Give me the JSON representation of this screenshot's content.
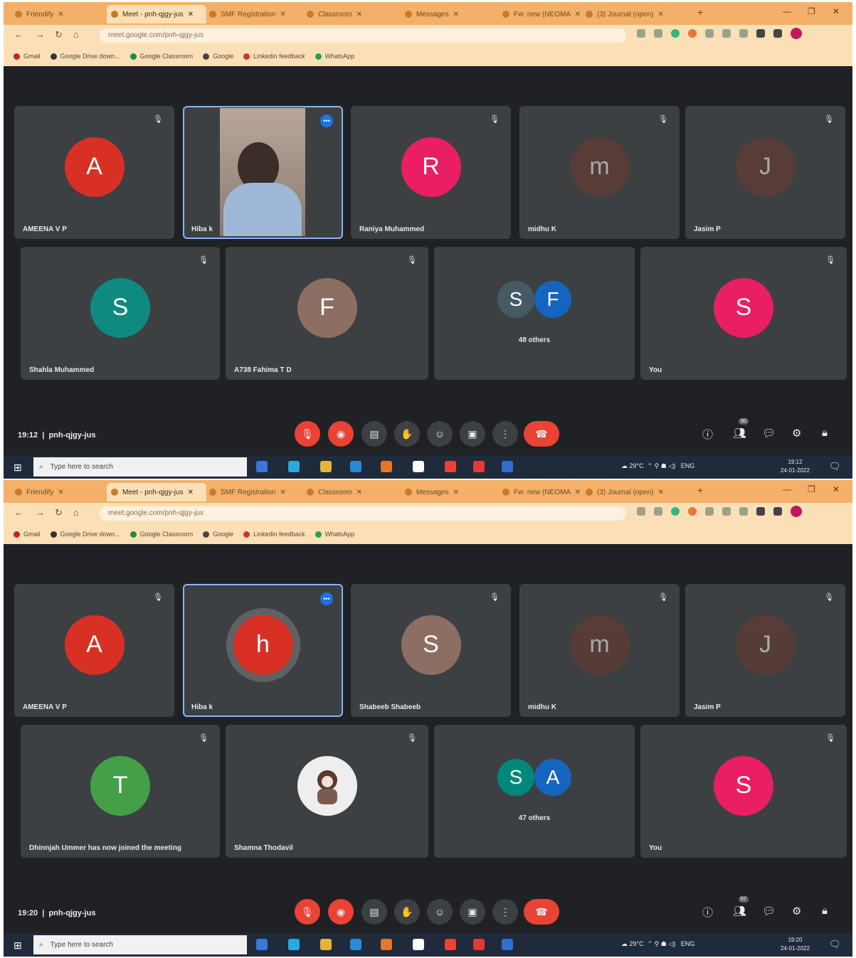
{
  "browser": {
    "tabs": [
      "Friendify",
      "Meet - pnh-qjgy-jus",
      "SMF Registration",
      "Classroom",
      "Messages",
      "Fw: new (NEOMA)",
      "(3) Journal (open)"
    ],
    "address": "meet.google.com/pnh-qjgy-jus",
    "bookmarks": [
      "Gmail",
      "Google Drive down...",
      "Google Classroom",
      "Google",
      "Linkedin feedback",
      "WhatsApp"
    ]
  },
  "screens": [
    {
      "meeting_time": "19:12",
      "meeting_code": "pnh-qjgy-jus",
      "people_count": "50",
      "tiles": [
        {
          "name": "AMEENA V P",
          "initial": "A",
          "color": "#d93025",
          "active": false,
          "video": false
        },
        {
          "name": "Hiba k",
          "initial": "",
          "color": "",
          "active": true,
          "video": true
        },
        {
          "name": "Raniya Muhammed",
          "initial": "R",
          "color": "#e91e63",
          "active": false,
          "video": false
        },
        {
          "name": "midhu K",
          "initial": "m",
          "color": "#6d3a2e",
          "active": false,
          "video": false
        },
        {
          "name": "Jasim P",
          "initial": "J",
          "color": "#6d3a2e",
          "active": false,
          "video": false
        },
        {
          "name": "Shahla Muhammed",
          "initial": "S",
          "color": "#0f8a80",
          "active": false,
          "video": false
        },
        {
          "name": "A738 Fahima T D",
          "initial": "F",
          "color": "#8d6e63",
          "active": false,
          "video": false
        },
        {
          "name": "",
          "others": "48 others",
          "initial1": "S",
          "color1": "#455a64",
          "initial2": "F",
          "color2": "#1565c0"
        },
        {
          "name": "You",
          "initial": "S",
          "color": "#e91e63",
          "active": false,
          "video": false
        }
      ]
    },
    {
      "meeting_time": "19:20",
      "meeting_code": "pnh-qjgy-jus",
      "people_count": "57",
      "tiles": [
        {
          "name": "AMEENA V P",
          "initial": "A",
          "color": "#d93025",
          "active": false,
          "video": false
        },
        {
          "name": "Hiba k",
          "initial": "h",
          "color": "#d93025",
          "active": true,
          "video": false
        },
        {
          "name": "Shabeeb Shabeeb",
          "initial": "S",
          "color": "#8d6e63",
          "active": false,
          "video": false
        },
        {
          "name": "midhu K",
          "initial": "m",
          "color": "#6d3a2e",
          "active": false,
          "video": false
        },
        {
          "name": "Jasim P",
          "initial": "J",
          "color": "#6d3a2e",
          "active": false,
          "video": false
        },
        {
          "name": "Dhinnjah Ummer has now joined the meeting",
          "initial": "T",
          "color": "#43a047",
          "active": false,
          "video": false
        },
        {
          "name": "Shamna Thodavil",
          "initial": "",
          "color": "#eeeeee",
          "active": false,
          "video": false
        },
        {
          "name": "",
          "others": "47 others",
          "initial1": "S",
          "color1": "#00897b",
          "initial2": "A",
          "color2": "#1565c0"
        },
        {
          "name": "You",
          "initial": "S",
          "color": "#e91e63",
          "active": false,
          "video": false
        }
      ]
    }
  ],
  "taskbar": {
    "search_placeholder": "Type here to search",
    "weather": "29°C",
    "language": "ENG",
    "date": "24-01-2022",
    "times": [
      "19:12",
      "19:20"
    ]
  }
}
